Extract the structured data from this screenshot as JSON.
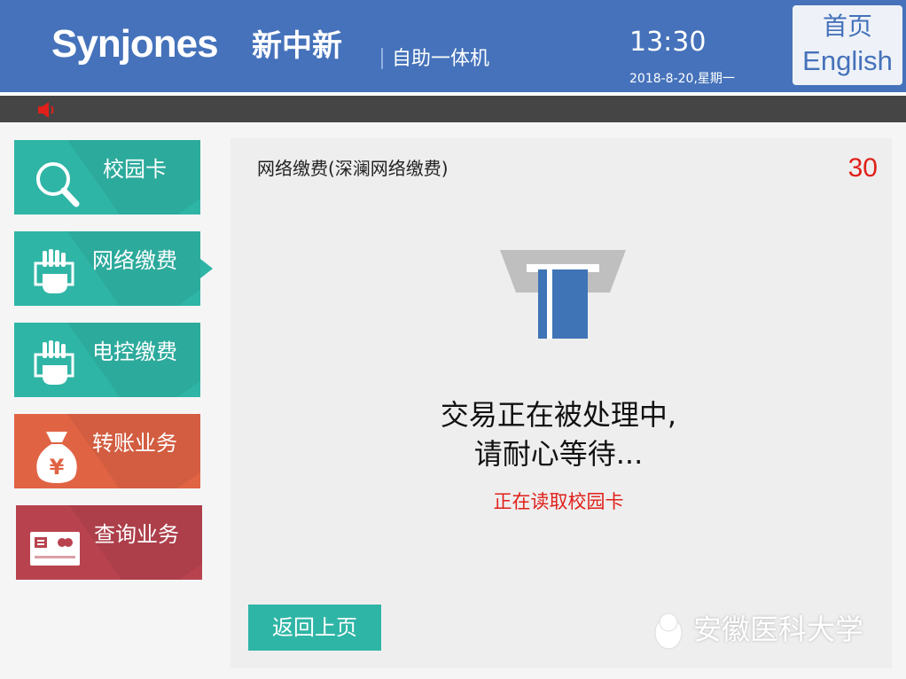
{
  "header": {
    "logo_text": "Synjones",
    "logo_cn": "新中新",
    "subtitle": "自助一体机",
    "time": "13:30",
    "date": "2018-8-20,星期一",
    "home_label": "首页",
    "english_label": "English"
  },
  "status_bar": {
    "sound_icon": "speaker-icon"
  },
  "menu": {
    "items": [
      {
        "label": "校园卡",
        "icon": "search-icon",
        "color": "#2fb5a6"
      },
      {
        "label": "网络缴费",
        "icon": "hand-card-icon",
        "color": "#2fb5a6",
        "selected": true
      },
      {
        "label": "电控缴费",
        "icon": "hand-card-icon",
        "color": "#2fb5a6"
      },
      {
        "label": "转账业务",
        "icon": "money-bag-icon",
        "color": "#e06344"
      },
      {
        "label": "查询业务",
        "icon": "bank-card-icon",
        "color": "#b8434f"
      }
    ]
  },
  "panel": {
    "title": "网络缴费(深澜网络缴费)",
    "countdown": "30",
    "message_line1": "交易正在被处理中,",
    "message_line2": "请耐心等待...",
    "status": "正在读取校园卡",
    "back_label": "返回上页"
  },
  "watermark": {
    "text": "安徽医科大学",
    "icon": "qq-penguin-icon"
  },
  "colors": {
    "header": "#4572ba",
    "teal": "#2fb5a6",
    "orange": "#e06344",
    "crimson": "#b8434f",
    "alert": "#e0201a"
  }
}
